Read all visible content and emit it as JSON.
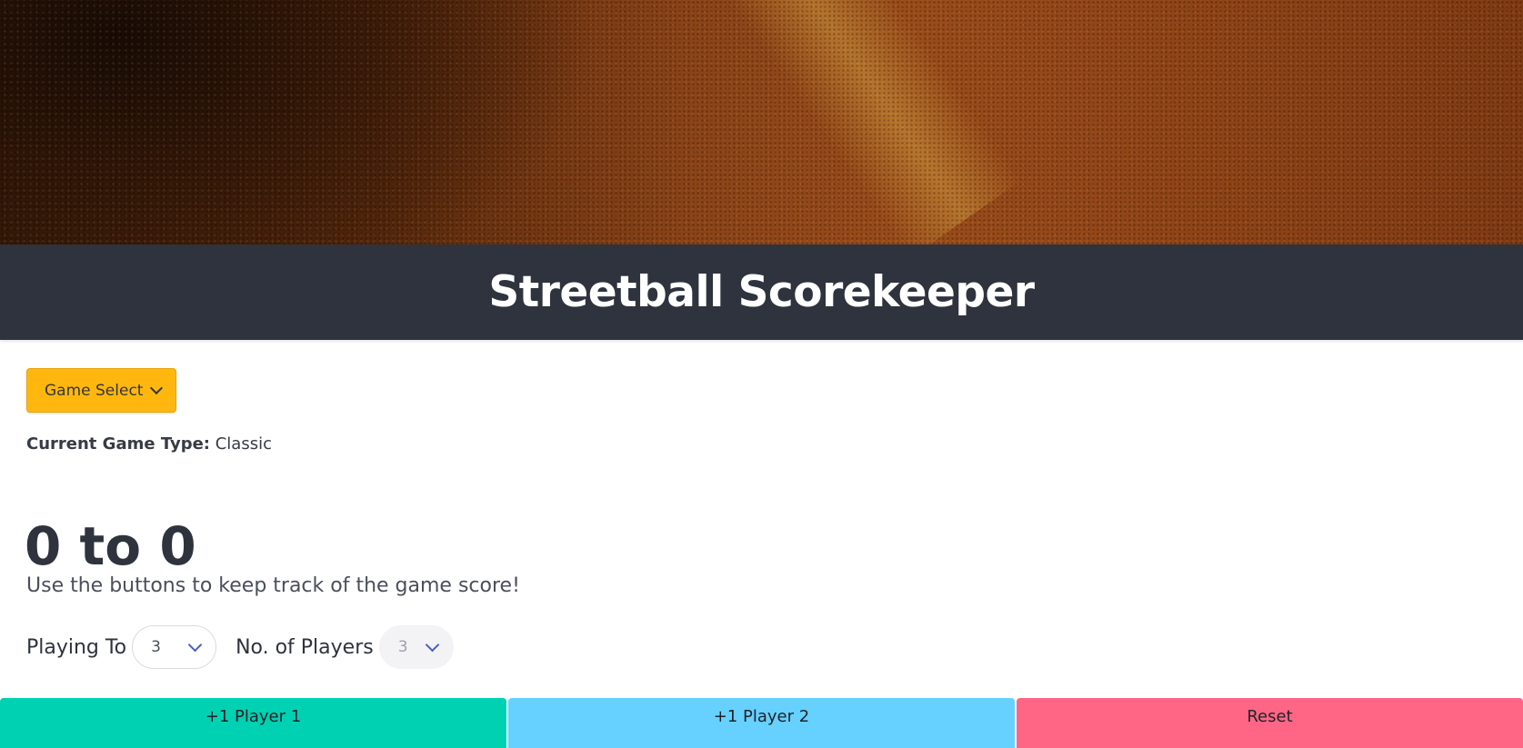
{
  "hero": {
    "image_desc_icon": "clay-court-texture"
  },
  "header": {
    "title": "Streetball Scorekeeper"
  },
  "game_select": {
    "label": "Game Select",
    "icon": "chevron-down-icon"
  },
  "game_type": {
    "label": "Current Game Type:",
    "value": "Classic"
  },
  "score": {
    "text": "0 to 0"
  },
  "instructions": "Use the buttons to keep track of the game score!",
  "controls": {
    "playing_to_label": "Playing To",
    "playing_to_value": "3",
    "players_label": "No. of Players",
    "players_value": "3"
  },
  "buttons": {
    "player1": "+1 Player 1",
    "player2": "+1 Player 2",
    "reset": "Reset"
  },
  "colors": {
    "header_bg": "#2e333d",
    "game_select_bg": "#ffb70f",
    "player1_bg": "#00d1b2",
    "player2_bg": "#66d1ff",
    "reset_bg": "#ff6685",
    "select_arrow": "#485fc7"
  }
}
